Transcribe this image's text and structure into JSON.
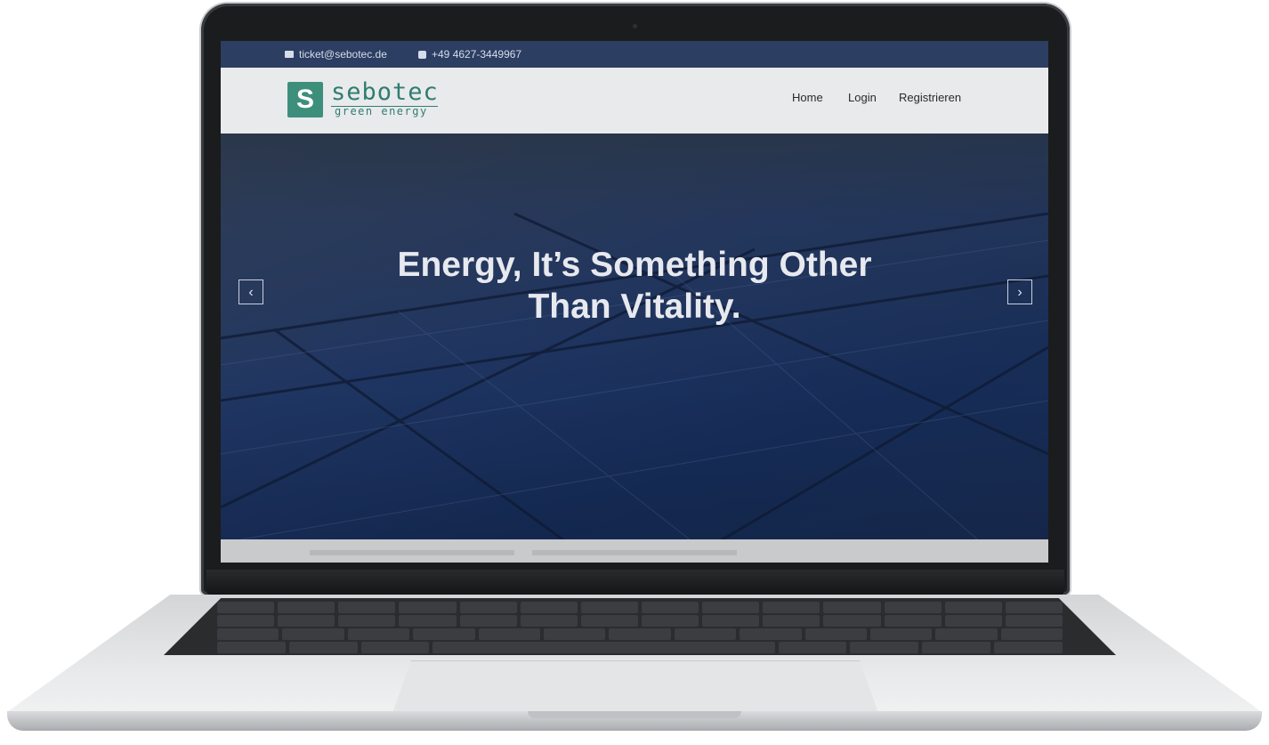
{
  "topbar": {
    "email": "ticket@sebotec.de",
    "phone": "+49 4627-3449967"
  },
  "brand": {
    "logo_letter": "S",
    "name": "sebotec",
    "tagline": "green energy",
    "accent_color": "#3d8f7c"
  },
  "nav": {
    "items": [
      {
        "label": "Home"
      },
      {
        "label": "Login"
      },
      {
        "label": "Registrieren"
      }
    ]
  },
  "hero": {
    "headline_line1": "Energy, It’s Something Other",
    "headline_line2": "Than Vitality.",
    "prev_arrow": "‹",
    "next_arrow": "›"
  },
  "icons": {
    "email": "envelope-icon",
    "phone": "phone-icon"
  }
}
